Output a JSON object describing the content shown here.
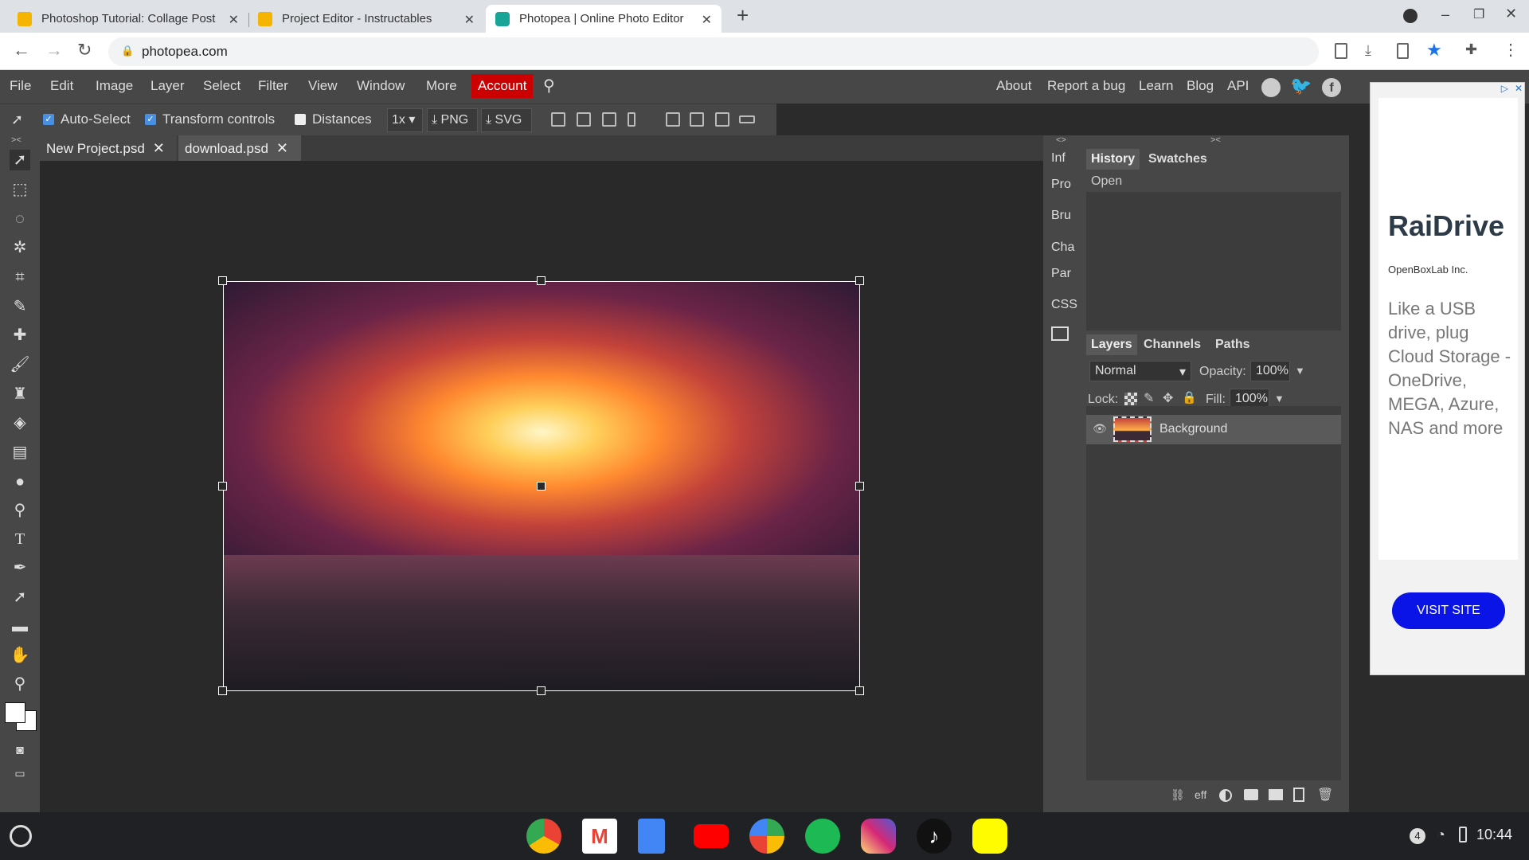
{
  "browser": {
    "tabs": [
      {
        "title": "Photoshop Tutorial: Collage Post",
        "active": false
      },
      {
        "title": "Project Editor - Instructables",
        "active": false
      },
      {
        "title": "Photopea | Online Photo Editor",
        "active": true
      }
    ],
    "new_tab": "+",
    "url": "photopea.com"
  },
  "menu": {
    "items": [
      "File",
      "Edit",
      "Image",
      "Layer",
      "Select",
      "Filter",
      "View",
      "Window",
      "More"
    ],
    "account": "Account",
    "right_links": [
      "About",
      "Report a bug",
      "Learn",
      "Blog",
      "API"
    ]
  },
  "options": {
    "auto_select": "Auto-Select",
    "transform_controls": "Transform controls",
    "distances": "Distances",
    "zoom": "1x",
    "png": "PNG",
    "svg": "SVG"
  },
  "documents": {
    "tabs": [
      "New Project.psd",
      "download.psd"
    ]
  },
  "side_icons": [
    "Inf",
    "Pro",
    "Bru",
    "Cha",
    "Par",
    "CSS"
  ],
  "panel_top": {
    "tabs": [
      "History",
      "Swatches"
    ],
    "history_items": [
      "Open"
    ]
  },
  "panel_layers": {
    "tabs": [
      "Layers",
      "Channels",
      "Paths"
    ],
    "blend_mode": "Normal",
    "opacity_label": "Opacity:",
    "opacity": "100%",
    "lock_label": "Lock:",
    "fill_label": "Fill:",
    "fill": "100%",
    "layers": [
      "Background"
    ],
    "footer_eff": "eff"
  },
  "ad": {
    "title": "RaiDrive",
    "company": "OpenBoxLab Inc.",
    "body": "Like a USB drive, plug Cloud Storage - OneDrive, MEGA, Azure, NAS and more",
    "cta": "VISIT SITE"
  },
  "shelf": {
    "time": "10:44",
    "notification_count": "4"
  },
  "colors": {
    "account_bg": "#cc0000",
    "panel_bg": "#474747",
    "ad_button": "#0a14e6"
  }
}
